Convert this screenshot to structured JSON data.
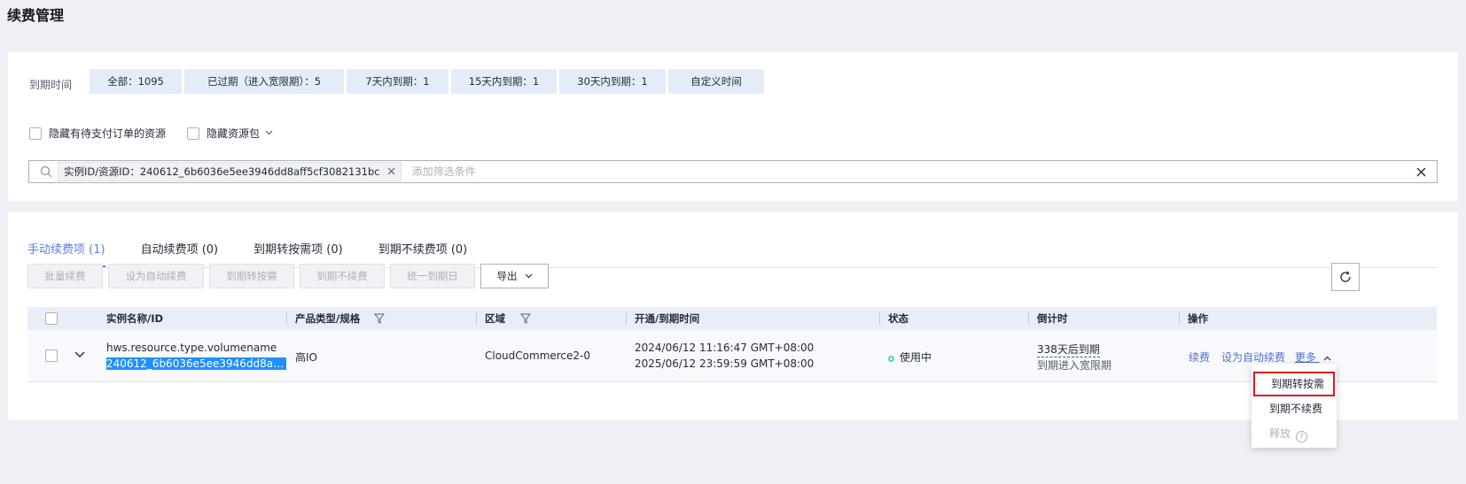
{
  "page": {
    "title": "续费管理"
  },
  "filters": {
    "expiry_label": "到期时间",
    "expiry_buttons": [
      "全部：1095",
      "已过期（进入宽限期）：5",
      "7天内到期：1",
      "15天内到期：1",
      "30天内到期：1",
      "自定义时间"
    ],
    "hide_pending_label": "隐藏有待支付订单的资源",
    "hide_package_label": "隐藏资源包",
    "search": {
      "tag_text": "实例ID/资源ID：240612_6b6036e5ee3946dd8aff5cf3082131bc",
      "placeholder": "添加筛选条件"
    }
  },
  "tabs": [
    {
      "label": "手动续费项 (1)",
      "active": true
    },
    {
      "label": "自动续费项 (0)"
    },
    {
      "label": "到期转按需项 (0)"
    },
    {
      "label": "到期不续费项 (0)"
    }
  ],
  "toolbar": {
    "buttons": [
      "批量续费",
      "设为自动续费",
      "到期转按需",
      "到期不续费",
      "统一到期日"
    ],
    "export_label": "导出"
  },
  "table": {
    "headers": {
      "name": "实例名称/ID",
      "product": "产品类型/规格",
      "region": "区域",
      "time": "开通/到期时间",
      "status": "状态",
      "countdown": "倒计时",
      "actions": "操作"
    },
    "row": {
      "name": "hws.resource.type.volumename",
      "id": "240612_6b6036e5ee3946dd8aff5cf3082131bc",
      "product": "高IO",
      "region": "CloudCommerce2-0",
      "open_time": "2024/06/12 11:16:47 GMT+08:00",
      "expire_time": "2025/06/12 23:59:59 GMT+08:00",
      "status": "使用中",
      "countdown": "338天后到期",
      "countdown_sub": "到期进入宽限期",
      "action_renew": "续费",
      "action_auto": "设为自动续费",
      "action_more": "更多"
    }
  },
  "more_menu": {
    "items": [
      "到期转按需",
      "到期不续费",
      "释放"
    ]
  },
  "colors": {
    "accent": "#5e7ce0",
    "link": "#526ecc",
    "status_ok": "#50d4ab",
    "highlight_box": "#e0161f",
    "selection": "#1e90ff"
  }
}
